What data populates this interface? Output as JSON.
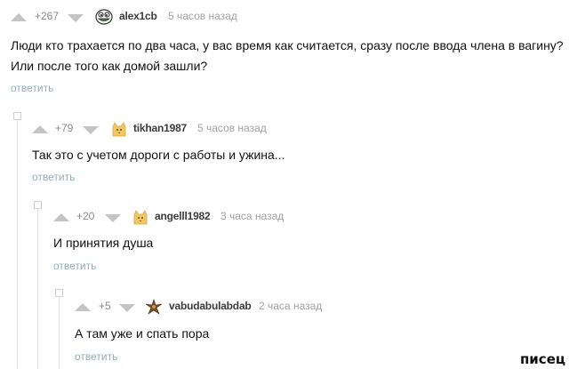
{
  "comments": [
    {
      "rating": "+267",
      "username": "alex1cb",
      "time": "5 часов назад",
      "avatar": "smiling-face-avatar",
      "text_lines": [
        "Люди кто трахается по два часа, у вас время как считается, сразу после ввода члена в вагину?",
        "Или после того как домой зашли?"
      ],
      "reply_label": "ответить"
    },
    {
      "rating": "+79",
      "username": "tikhan1987",
      "time": "5 часов назад",
      "avatar": "cat-avatar",
      "text_lines": [
        "Так это с учетом дороги с работы и ужина..."
      ],
      "reply_label": "ответить"
    },
    {
      "rating": "+20",
      "username": "angelll1982",
      "time": "3 часа назад",
      "avatar": "cat-avatar",
      "text_lines": [
        "И принятия душа"
      ],
      "reply_label": "ответить"
    },
    {
      "rating": "+5",
      "username": "vabudabulabdab",
      "time": "2 часа назад",
      "avatar": "star-figure-avatar",
      "text_lines": [
        "А там уже и спать пора"
      ],
      "reply_label": "ответить"
    }
  ],
  "watermark": "писец",
  "colors": {
    "vote_arrow": "#c4c4c4",
    "reply_link": "#8bb0c2",
    "time": "#a2a2a2",
    "thread_line": "#e2e2e2"
  }
}
